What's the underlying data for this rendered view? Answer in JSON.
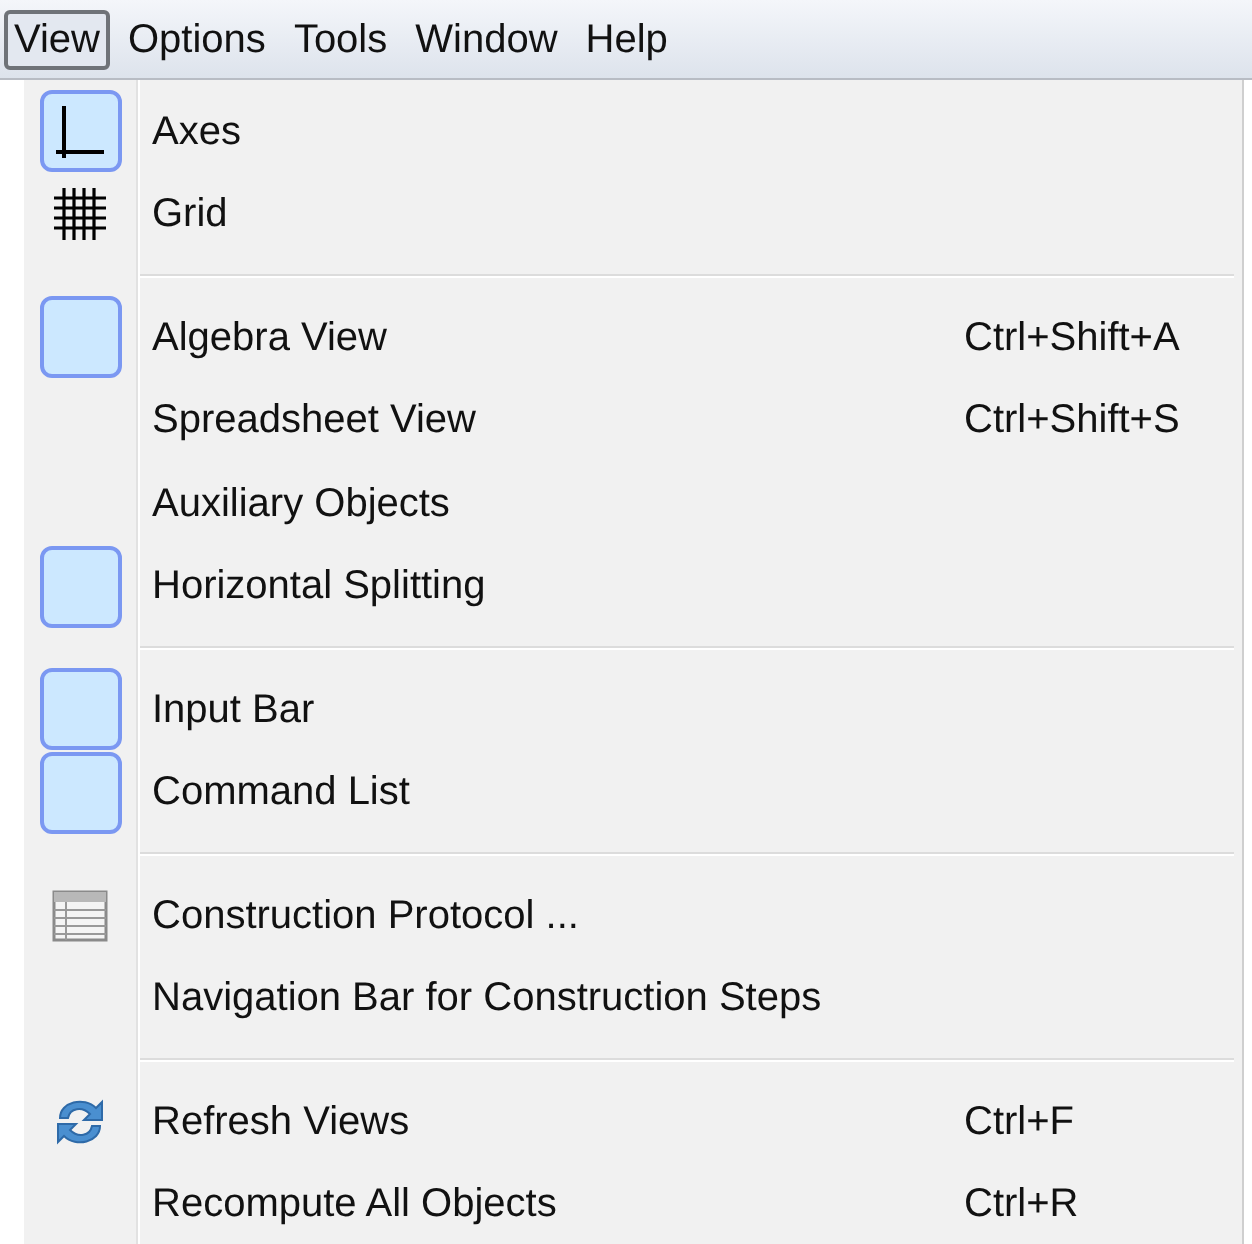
{
  "menu_bar": [
    {
      "label": "View",
      "selected": true
    },
    {
      "label": "Options",
      "selected": false
    },
    {
      "label": "Tools",
      "selected": false
    },
    {
      "label": "Window",
      "selected": false
    },
    {
      "label": "Help",
      "selected": false
    }
  ],
  "menu": {
    "groups": [
      {
        "items": [
          {
            "label": "Axes",
            "kind": "axes",
            "checked": true
          },
          {
            "label": "Grid",
            "kind": "grid",
            "checked": false
          }
        ]
      },
      {
        "items": [
          {
            "label": "Algebra View",
            "shortcut": "Ctrl+Shift+A",
            "kind": "plain",
            "checked": true
          },
          {
            "label": "Spreadsheet View",
            "shortcut": "Ctrl+Shift+S",
            "kind": "plain",
            "checked": false
          },
          {
            "label": "Auxiliary Objects",
            "kind": "plain",
            "checked": false
          },
          {
            "label": "Horizontal Splitting",
            "kind": "plain",
            "checked": true
          }
        ]
      },
      {
        "items": [
          {
            "label": "Input Bar",
            "kind": "plain",
            "checked": true
          },
          {
            "label": "Command List",
            "kind": "plain",
            "checked": true
          }
        ]
      },
      {
        "items": [
          {
            "label": "Construction Protocol ...",
            "kind": "table",
            "checked": false
          },
          {
            "label": "Navigation Bar for Construction Steps",
            "kind": "plain",
            "checked": false
          }
        ]
      },
      {
        "items": [
          {
            "label": "Refresh Views",
            "shortcut": "Ctrl+F",
            "kind": "refresh",
            "checked": false
          },
          {
            "label": "Recompute All Objects",
            "shortcut": "Ctrl+R",
            "kind": "plain",
            "checked": false
          }
        ]
      }
    ]
  }
}
